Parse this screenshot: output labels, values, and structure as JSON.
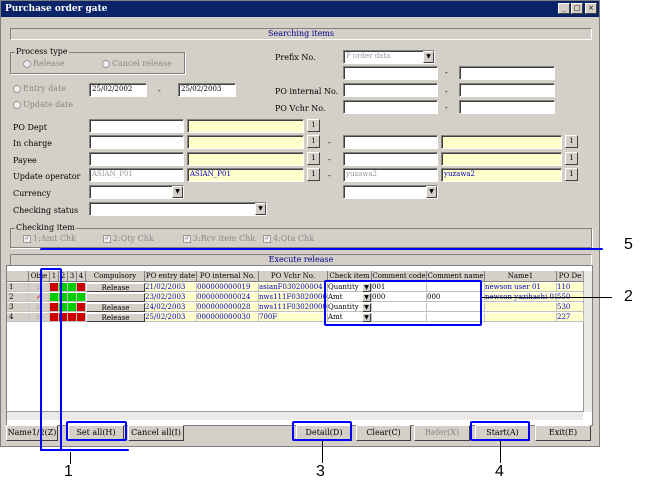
{
  "window": {
    "title": "Purchase order gate",
    "controls": [
      "_",
      "□",
      "×"
    ]
  },
  "search": {
    "section_title": "Searching items",
    "process_type": {
      "label": "Process type",
      "options": [
        "Release",
        "Cancel release"
      ]
    },
    "date_type": {
      "options": [
        "Entry date",
        "Update date"
      ],
      "from": "25/02/2002",
      "to": "25/02/2003"
    },
    "prefix": {
      "label": "Prefix No.",
      "value": "P order data"
    },
    "po_internal": {
      "label": "PO internal No."
    },
    "po_vchr": {
      "label": "PO Vchr No."
    },
    "po_dept": {
      "label": "PO Dept"
    },
    "in_charge": {
      "label": "In charge"
    },
    "payee": {
      "label": "Payee"
    },
    "update_operator": {
      "label": "Update operator",
      "code_from": "ASIAN_P01",
      "name_from": "ASIAN_P01",
      "code_to": "yuzawa2",
      "name_to": "yuzawa2"
    },
    "currency": {
      "label": "Currency"
    },
    "checking_status": {
      "label": "Checking status"
    },
    "checking_item": {
      "label": "Checking item",
      "items": [
        "1:Amt Chk",
        "2:Qty Chk",
        "3:Rcv item Chk",
        "4:Qta Chk"
      ]
    },
    "lookup_btn": "1",
    "dash": "-"
  },
  "release": {
    "section_title": "Execute release",
    "columns": [
      "Obje",
      "1",
      "2",
      "3",
      "4",
      "Compulsory",
      "PO entry date",
      "PO internal No.",
      "PO Vchr No.",
      "Check item",
      "Comment code",
      "Comment name",
      "Name1",
      "PO De"
    ],
    "rows": [
      {
        "no": "1",
        "compulsory": "Release",
        "entry": "21/02/2003",
        "internal": "000000000019",
        "vchr": "asianF030200004",
        "check": "Quantity",
        "ccode": "001",
        "cname": "",
        "name1": "newson user 01",
        "pode": "110"
      },
      {
        "no": "2",
        "compulsory": "",
        "entry": "23/02/2003",
        "internal": "000000000024",
        "vchr": "nws111F030200001",
        "check": "Amt",
        "ccode": "000",
        "cname": "000",
        "name1": "newson yazihashi 01",
        "pode": "550"
      },
      {
        "no": "3",
        "compulsory": "Release",
        "entry": "24/02/2003",
        "internal": "000000000028",
        "vchr": "nws111F030200003",
        "check": "Quantity",
        "ccode": "",
        "cname": "",
        "name1": "",
        "pode": "530"
      },
      {
        "no": "4",
        "compulsory": "Release",
        "entry": "25/02/2003",
        "internal": "000000000030",
        "vchr": "700F",
        "check": "Amt",
        "ccode": "",
        "cname": "",
        "name1": "",
        "pode": "227"
      }
    ]
  },
  "buttons": {
    "name": "Name1/2(Z)",
    "set_all": "Set all(H)",
    "cancel_all": "Cancel all(I)",
    "detail": "Detail(D)",
    "clear": "Clear(C)",
    "refer": "Refer(X)",
    "start": "Start(A)",
    "exit": "Exit(E)"
  },
  "callouts": {
    "c1": "1",
    "c2": "2",
    "c3": "3",
    "c4": "4",
    "c5": "5"
  }
}
